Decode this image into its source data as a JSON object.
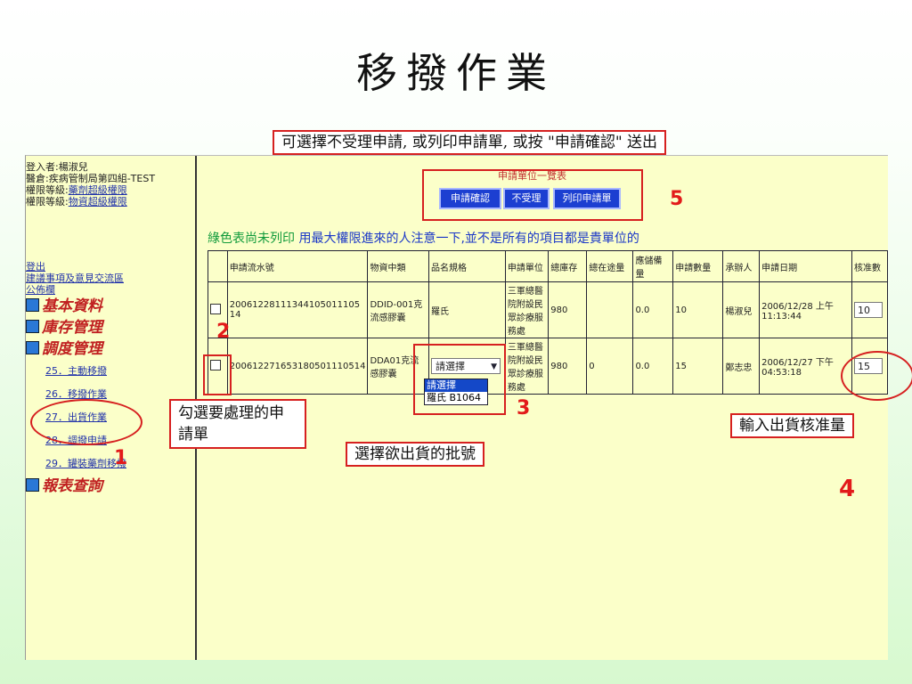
{
  "slide_title": "移撥作業",
  "top_callout": "可選擇不受理申請, 或列印申請單, 或按 \"申請確認\" 送出",
  "sidebar": {
    "login_line": "登入者:楊淑兒",
    "warehouse_line": "醫倉:疾病管制局第四組-TEST",
    "perm_drug_prefix": "權限等級:",
    "perm_drug_link": "藥劑超級權限",
    "perm_material_prefix": "權限等級:",
    "perm_material_link": "物資超級權限",
    "logout": "登出",
    "suggestion": "建議事項及意見交流區",
    "bulletin": "公佈欄",
    "sections": {
      "basic": "基本資料",
      "inventory": "庫存管理",
      "dispatch": "調度管理",
      "reports": "報表查詢"
    },
    "dispatch_items": [
      "25．主動移撥",
      "26．移撥作業",
      "27．出貨作業",
      "28．調撥申請",
      "29．罐裝藥劑移撥"
    ]
  },
  "main": {
    "unit_title": "申請單位一覽表",
    "buttons": {
      "confirm": "申請確認",
      "reject": "不受理",
      "print": "列印申請單"
    },
    "notice_green": "綠色表尚未列印",
    "notice_blue": " 用最大權限進來的人注意一下,並不是所有的項目都是貴單位的"
  },
  "table": {
    "headers": [
      "",
      "申請流水號",
      "物資中類",
      "品名規格",
      "申請單位",
      "總庫存",
      "總在途量",
      "應儲備量",
      "申請數量",
      "承辦人",
      "申請日期",
      "核准數"
    ],
    "rows": [
      {
        "serial": "20061228111344105011105 14",
        "category": "DDID-001克流感膠囊",
        "item": "羅氏",
        "unit": "三軍總醫院附設民眾診療服務處",
        "stock": "980",
        "in_transit": "",
        "reserve": "0.0",
        "qty": "10",
        "handler": "楊淑兒",
        "date": "2006/12/28 上午 11:13:44",
        "approved": "10"
      },
      {
        "serial": "200612271653180501110514",
        "category": "DDA01克流感膠囊",
        "item_select": "請選擇",
        "unit": "三軍總醫院附設民眾診療服務處",
        "stock": "980",
        "in_transit": "0",
        "reserve": "0.0",
        "qty": "15",
        "handler": "鄭志忠",
        "date": "2006/12/27 下午 04:53:18",
        "approved": "15"
      }
    ],
    "dropdown_options": [
      "請選擇",
      "羅氏 B1064"
    ]
  },
  "callouts": {
    "check": "勾選要處理的申請單",
    "batch": "選擇欲出貨的批號",
    "approve": "輸入出貨核准量"
  },
  "markers": [
    "1",
    "2",
    "3",
    "4",
    "5"
  ],
  "colors": {
    "accent_red": "#d62020",
    "button_blue": "#1c3fd1",
    "notice_green": "#0f9a3a",
    "notice_blue": "#1a37c8"
  }
}
